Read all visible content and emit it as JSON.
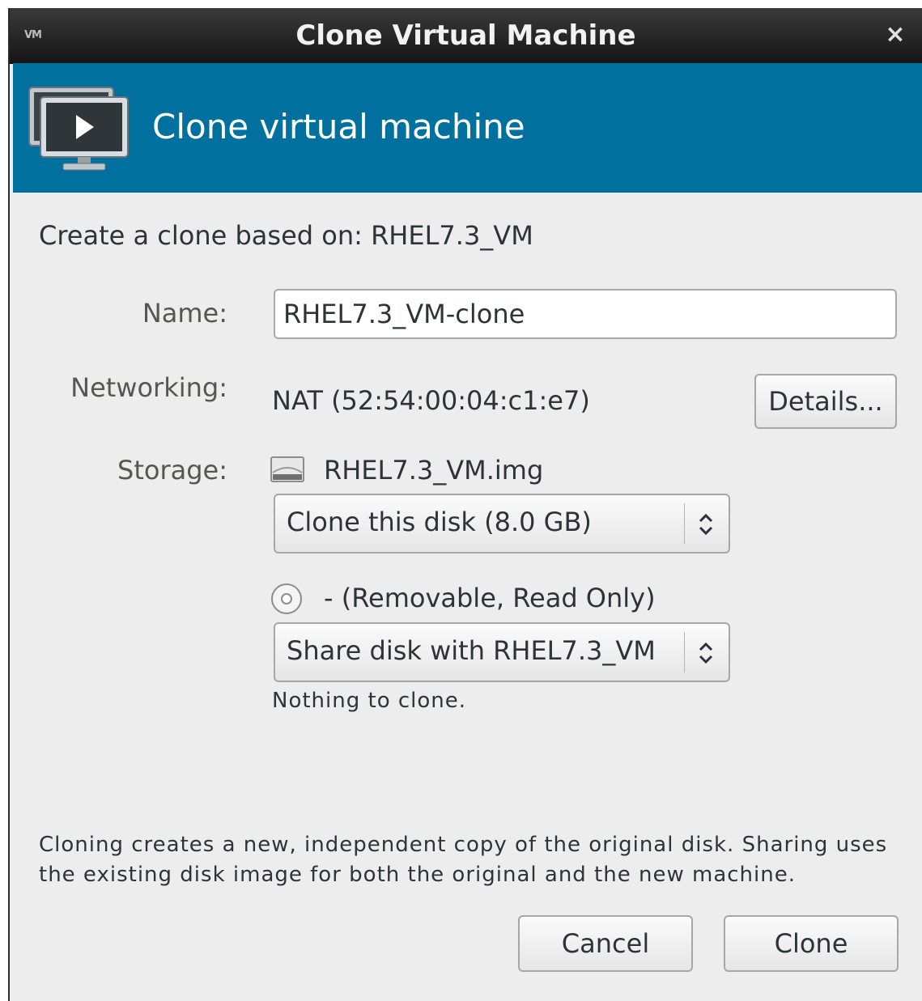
{
  "window": {
    "title": "Clone Virtual Machine",
    "app_badge": "VM",
    "close_glyph": "×"
  },
  "banner": {
    "title": "Clone virtual machine",
    "icon": "monitor-play-icon",
    "color": "#00719f"
  },
  "based_on_text": "Create a clone based on: RHEL7.3_VM",
  "name": {
    "label": "Name:",
    "value": "RHEL7.3_VM-clone"
  },
  "networking": {
    "label": "Networking:",
    "value": "NAT (52:54:00:04:c1:e7)",
    "details_button": "Details..."
  },
  "storage": {
    "label": "Storage:",
    "disks": [
      {
        "icon": "harddisk-icon",
        "name": "RHEL7.3_VM.img",
        "action": "Clone this disk (8.0 GB)"
      },
      {
        "icon": "cdrom-icon",
        "name": "- (Removable, Read Only)",
        "action": "Share disk with RHEL7.3_VM",
        "note": "Nothing to clone."
      }
    ]
  },
  "help_text": "Cloning creates a new, independent copy of the original disk. Sharing uses the existing disk image for both the original and the new machine.",
  "buttons": {
    "cancel": "Cancel",
    "clone": "Clone"
  }
}
